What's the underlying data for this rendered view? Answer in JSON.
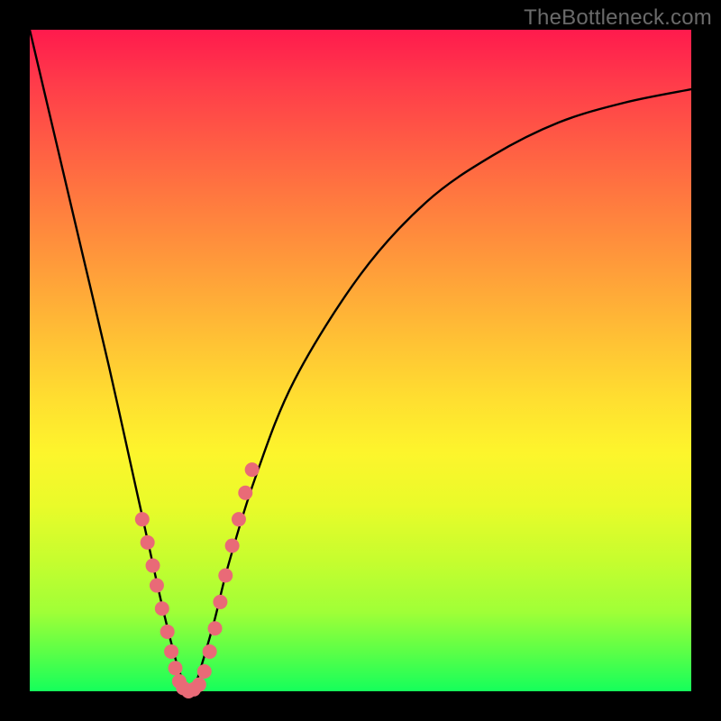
{
  "watermark": "TheBottleneck.com",
  "colors": {
    "frame": "#000000",
    "curve": "#000000",
    "dot": "#e96a77",
    "gradient_top": "#ff1a4d",
    "gradient_bottom": "#15ff5b"
  },
  "chart_data": {
    "type": "line",
    "title": "",
    "xlabel": "",
    "ylabel": "",
    "xlim": [
      0,
      100
    ],
    "ylim": [
      0,
      100
    ],
    "note": "Axes are implicit percentage scales; no tick labels shown. y≈0 is green (ideal), y≈100 is red (worst). Curve is a single V-shaped bottleneck line reaching y≈0 near x≈24.",
    "series": [
      {
        "name": "bottleneck-curve",
        "mode": "line",
        "x": [
          0,
          4,
          8,
          12,
          16,
          18,
          20,
          22,
          23,
          24,
          25,
          26,
          28,
          30,
          34,
          40,
          50,
          60,
          70,
          80,
          90,
          100
        ],
        "y": [
          100,
          83,
          66,
          49,
          31,
          22,
          13,
          5,
          2,
          0,
          1,
          4,
          11,
          19,
          32,
          47,
          63,
          74,
          81,
          86,
          89,
          91
        ]
      },
      {
        "name": "left-branch-dots",
        "mode": "markers",
        "x": [
          17.0,
          17.8,
          18.6,
          19.2,
          20.0,
          20.8,
          21.4,
          22.0,
          22.6
        ],
        "y": [
          26.0,
          22.5,
          19.0,
          16.0,
          12.5,
          9.0,
          6.0,
          3.5,
          1.5
        ]
      },
      {
        "name": "valley-dots",
        "mode": "markers",
        "x": [
          23.2,
          24.0,
          24.8,
          25.6
        ],
        "y": [
          0.5,
          0.0,
          0.3,
          1.0
        ]
      },
      {
        "name": "right-branch-dots",
        "mode": "markers",
        "x": [
          26.4,
          27.2,
          28.0,
          28.8,
          29.6,
          30.6,
          31.6,
          32.6,
          33.6
        ],
        "y": [
          3.0,
          6.0,
          9.5,
          13.5,
          17.5,
          22.0,
          26.0,
          30.0,
          33.5
        ]
      }
    ]
  }
}
